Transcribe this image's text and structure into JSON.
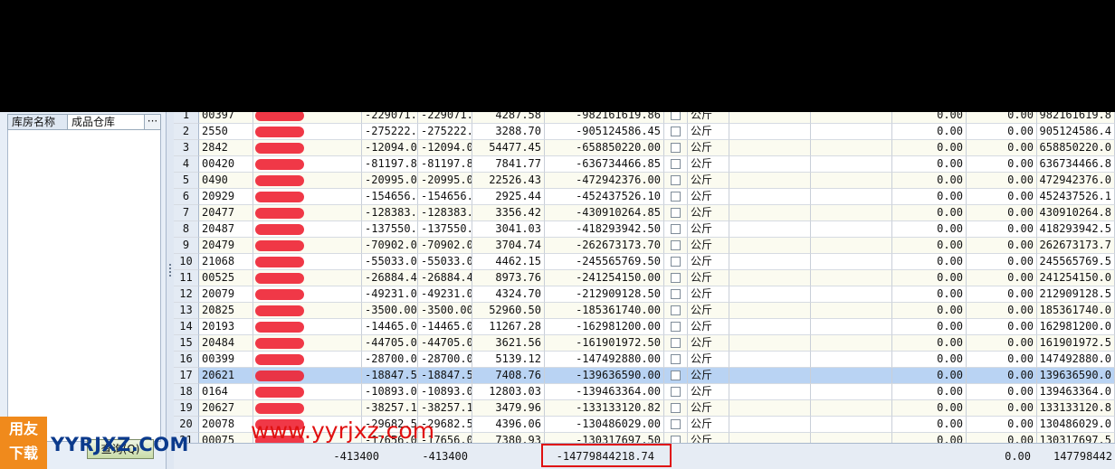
{
  "filter": {
    "label": "库房名称",
    "value": "成品仓库",
    "button": "···"
  },
  "query_button": "查询(Q)",
  "rows": [
    {
      "idx": "1",
      "code": "00397",
      "a": "-229071.",
      "b": "-229071.",
      "price": "4287.58",
      "amount": "-982161619.86",
      "unit": "公斤",
      "z": "0.00",
      "z2": "0.00",
      "total": "982161619.8"
    },
    {
      "idx": "2",
      "code": "2550",
      "a": "-275222.",
      "b": "-275222.",
      "price": "3288.70",
      "amount": "-905124586.45",
      "unit": "公斤",
      "z": "0.00",
      "z2": "0.00",
      "total": "905124586.4"
    },
    {
      "idx": "3",
      "code": "2842",
      "a": "-12094.0",
      "b": "-12094.0",
      "price": "54477.45",
      "amount": "-658850220.00",
      "unit": "公斤",
      "z": "0.00",
      "z2": "0.00",
      "total": "658850220.0"
    },
    {
      "idx": "4",
      "code": "00420",
      "a": "-81197.8",
      "b": "-81197.8",
      "price": "7841.77",
      "amount": "-636734466.85",
      "unit": "公斤",
      "z": "0.00",
      "z2": "0.00",
      "total": "636734466.8"
    },
    {
      "idx": "5",
      "code": "0490",
      "a": "-20995.0",
      "b": "-20995.0",
      "price": "22526.43",
      "amount": "-472942376.00",
      "unit": "公斤",
      "z": "0.00",
      "z2": "0.00",
      "total": "472942376.0"
    },
    {
      "idx": "6",
      "code": "20929",
      "a": "-154656.",
      "b": "-154656.",
      "price": "2925.44",
      "amount": "-452437526.10",
      "unit": "公斤",
      "z": "0.00",
      "z2": "0.00",
      "total": "452437526.1"
    },
    {
      "idx": "7",
      "code": "20477",
      "a": "-128383.",
      "b": "-128383.",
      "price": "3356.42",
      "amount": "-430910264.85",
      "unit": "公斤",
      "z": "0.00",
      "z2": "0.00",
      "total": "430910264.8"
    },
    {
      "idx": "8",
      "code": "20487",
      "a": "-137550.",
      "b": "-137550.",
      "price": "3041.03",
      "amount": "-418293942.50",
      "unit": "公斤",
      "z": "0.00",
      "z2": "0.00",
      "total": "418293942.5"
    },
    {
      "idx": "9",
      "code": "20479",
      "a": "-70902.0",
      "b": "-70902.0",
      "price": "3704.74",
      "amount": "-262673173.70",
      "unit": "公斤",
      "z": "0.00",
      "z2": "0.00",
      "total": "262673173.7"
    },
    {
      "idx": "10",
      "code": "21068",
      "a": "-55033.0",
      "b": "-55033.0",
      "price": "4462.15",
      "amount": "-245565769.50",
      "unit": "公斤",
      "z": "0.00",
      "z2": "0.00",
      "total": "245565769.5"
    },
    {
      "idx": "11",
      "code": "00525",
      "a": "-26884.4",
      "b": "-26884.4",
      "price": "8973.76",
      "amount": "-241254150.00",
      "unit": "公斤",
      "z": "0.00",
      "z2": "0.00",
      "total": "241254150.0"
    },
    {
      "idx": "12",
      "code": "20079",
      "a": "-49231.0",
      "b": "-49231.0",
      "price": "4324.70",
      "amount": "-212909128.50",
      "unit": "公斤",
      "z": "0.00",
      "z2": "0.00",
      "total": "212909128.5"
    },
    {
      "idx": "13",
      "code": "20825",
      "a": "-3500.00",
      "b": "-3500.00",
      "price": "52960.50",
      "amount": "-185361740.00",
      "unit": "公斤",
      "z": "0.00",
      "z2": "0.00",
      "total": "185361740.0"
    },
    {
      "idx": "14",
      "code": "20193",
      "a": "-14465.0",
      "b": "-14465.0",
      "price": "11267.28",
      "amount": "-162981200.00",
      "unit": "公斤",
      "z": "0.00",
      "z2": "0.00",
      "total": "162981200.0"
    },
    {
      "idx": "15",
      "code": "20484",
      "a": "-44705.0",
      "b": "-44705.0",
      "price": "3621.56",
      "amount": "-161901972.50",
      "unit": "公斤",
      "z": "0.00",
      "z2": "0.00",
      "total": "161901972.5"
    },
    {
      "idx": "16",
      "code": "00399",
      "a": "-28700.0",
      "b": "-28700.0",
      "price": "5139.12",
      "amount": "-147492880.00",
      "unit": "公斤",
      "z": "0.00",
      "z2": "0.00",
      "total": "147492880.0"
    },
    {
      "idx": "17",
      "code": "20621",
      "a": "-18847.5",
      "b": "-18847.5",
      "price": "7408.76",
      "amount": "-139636590.00",
      "unit": "公斤",
      "z": "0.00",
      "z2": "0.00",
      "total": "139636590.0"
    },
    {
      "idx": "18",
      "code": "0164",
      "a": "-10893.0",
      "b": "-10893.0",
      "price": "12803.03",
      "amount": "-139463364.00",
      "unit": "公斤",
      "z": "0.00",
      "z2": "0.00",
      "total": "139463364.0"
    },
    {
      "idx": "19",
      "code": "20627",
      "a": "-38257.1",
      "b": "-38257.1",
      "price": "3479.96",
      "amount": "-133133120.82",
      "unit": "公斤",
      "z": "0.00",
      "z2": "0.00",
      "total": "133133120.8"
    },
    {
      "idx": "20",
      "code": "20078",
      "a": "-29682.5",
      "b": "-29682.5",
      "price": "4396.06",
      "amount": "-130486029.00",
      "unit": "公斤",
      "z": "0.00",
      "z2": "0.00",
      "total": "130486029.0"
    },
    {
      "idx": "21",
      "code": "00075",
      "a": "-17656.0",
      "b": "-17656.0",
      "price": "7380.93",
      "amount": "-130317697.50",
      "unit": "公斤",
      "z": "0.00",
      "z2": "0.00",
      "total": "130317697.5"
    }
  ],
  "selected_index": 16,
  "footer": {
    "a": "-413400",
    "b": "-413400",
    "amount": "-14779844218.74",
    "z": "0.00",
    "total": "147798442"
  },
  "watermark": {
    "logo_top": "用友",
    "logo_bottom": "下载",
    "site": "YYRJXZ.COM",
    "url": "www.yyrjxz.com"
  },
  "colors": {
    "selected_row": "#b9d3f3",
    "highlight_box": "#e01010",
    "redaction": "#ee2233"
  }
}
